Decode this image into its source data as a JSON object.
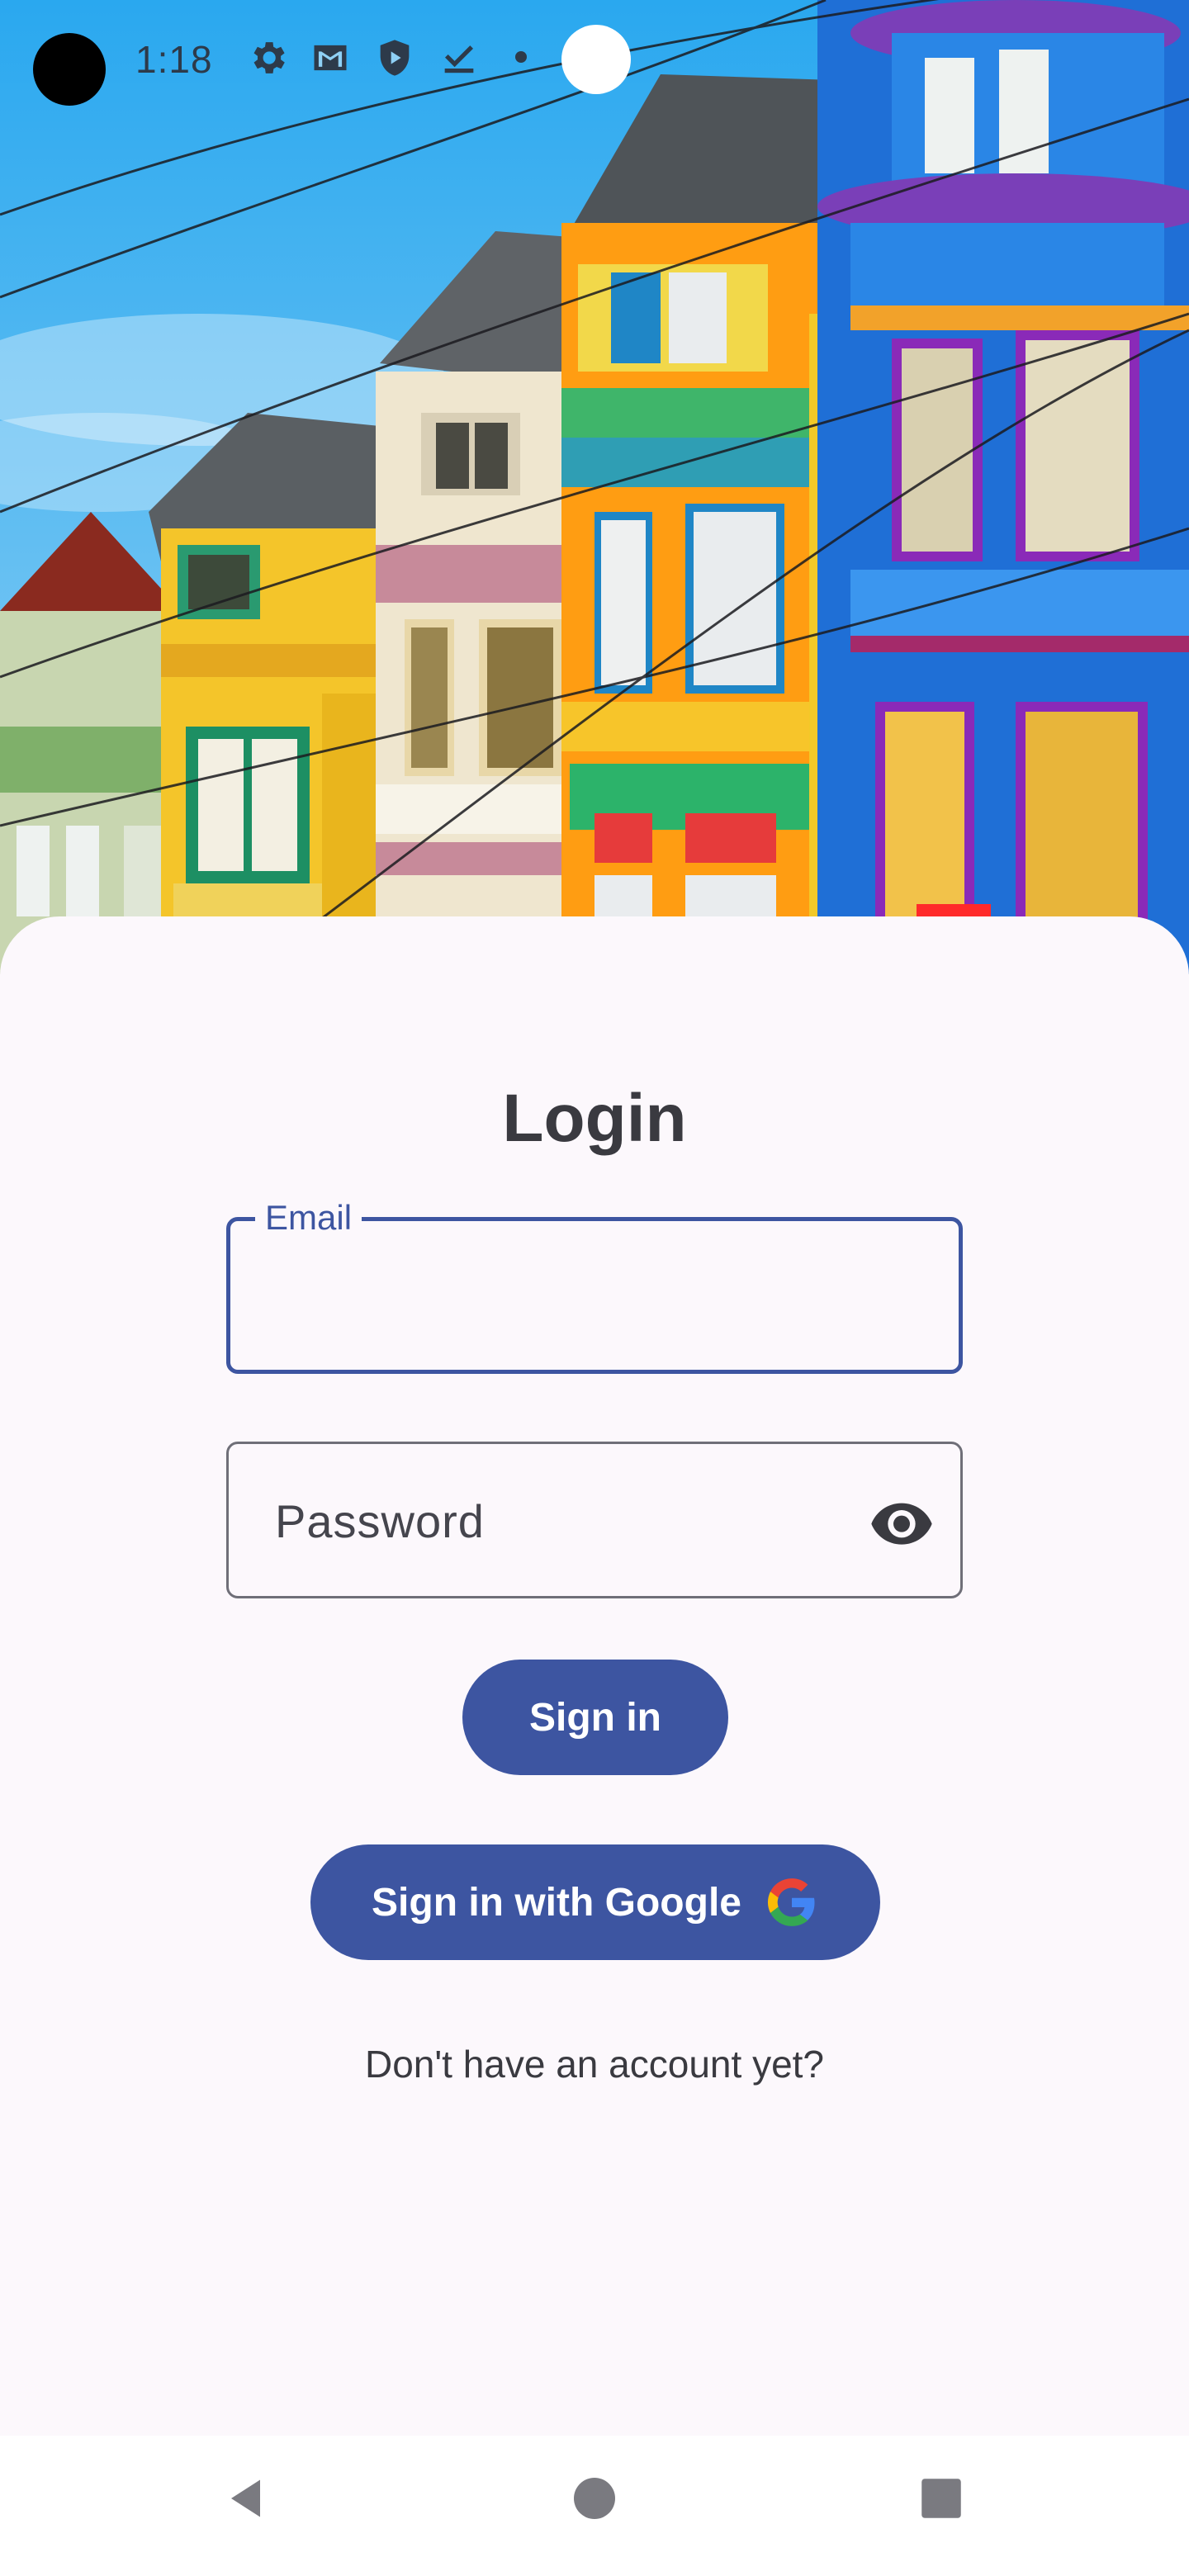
{
  "status_bar": {
    "time": "1:18",
    "icons": [
      "gear-icon",
      "mail-icon",
      "shield-icon",
      "download-done-icon"
    ]
  },
  "hero": {
    "image": "colorful-victorian-houses-illustration"
  },
  "login": {
    "title": "Login",
    "email": {
      "label": "Email",
      "value": ""
    },
    "password": {
      "placeholder": "Password",
      "value": "",
      "toggle_icon": "eye-icon"
    },
    "sign_in_label": "Sign in",
    "google_sign_in_label": "Sign in with Google",
    "google_icon": "google-g-icon",
    "signup_prompt": "Don't have an account yet?"
  },
  "navigation": {
    "back_icon": "back-triangle-icon",
    "home_icon": "home-circle-icon",
    "recents_icon": "recents-square-icon"
  },
  "colors": {
    "primary": "#3d55a1",
    "surface": "#fcf8fc",
    "text": "#3a3a40"
  }
}
